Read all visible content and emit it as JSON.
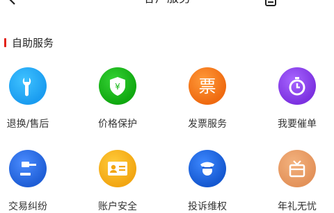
{
  "header": {
    "title": "客户服务"
  },
  "section": {
    "title": "自助服务"
  },
  "services": [
    {
      "label": "退换/售后",
      "icon": "wrench-icon",
      "color": "#1a9cf0"
    },
    {
      "label": "价格保护",
      "icon": "price-protect-shield-icon",
      "color": "#15b815"
    },
    {
      "label": "发票服务",
      "icon": "invoice-icon",
      "color": "#f47a1b",
      "glyph": "票"
    },
    {
      "label": "我要催单",
      "icon": "timer-icon",
      "color": "#8a3fe6"
    },
    {
      "label": "交易纠纷",
      "icon": "gavel-icon",
      "color": "#2b6fe6"
    },
    {
      "label": "账户安全",
      "icon": "id-card-icon",
      "color": "#f4b11c"
    },
    {
      "label": "投诉维权",
      "icon": "police-officer-icon",
      "color": "#1f6de0"
    },
    {
      "label": "年礼无忧",
      "icon": "gift-box-icon",
      "color": "#e8a06a"
    }
  ]
}
